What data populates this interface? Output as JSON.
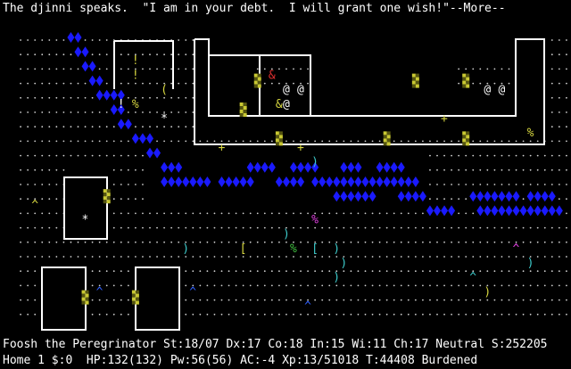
{
  "message": "The djinni speaks.  \"I am in your debt.  I will grant one wish!\"--More--",
  "status": {
    "line1": "Foosh the Peregrinator St:18/07 Dx:17 Co:18 In:15 Wi:11 Ch:17 Neutral S:252205",
    "line2": "Home 1 $:0  HP:132(132) Pw:56(56) AC:-4 Xp:13/51018 T:44408 Burdened"
  },
  "colors": {
    "background": "#000000",
    "text": "#ffffff",
    "wall": "#ffffff",
    "floor_dot": "#d0d0d0",
    "water": "#1a1aff",
    "door_tile": "#c8c832",
    "item_yellow": "#d6d640",
    "item_cyan": "#3cc8c8",
    "item_magenta": "#e040e0",
    "item_green": "#40c040",
    "player_red": "#e03030",
    "trap_blue": "#3060ff"
  },
  "glyphs": {
    "floor": ".",
    "water": "~",
    "player": "@",
    "djinni": "&",
    "ring": "=",
    "amulet": "\"",
    "boulder": "*",
    "door": "+",
    "spellbook": "+",
    "potion": "!",
    "trap": "^",
    "armor": "[",
    "tool": "(",
    "food": "%",
    "weapon": ")"
  }
}
